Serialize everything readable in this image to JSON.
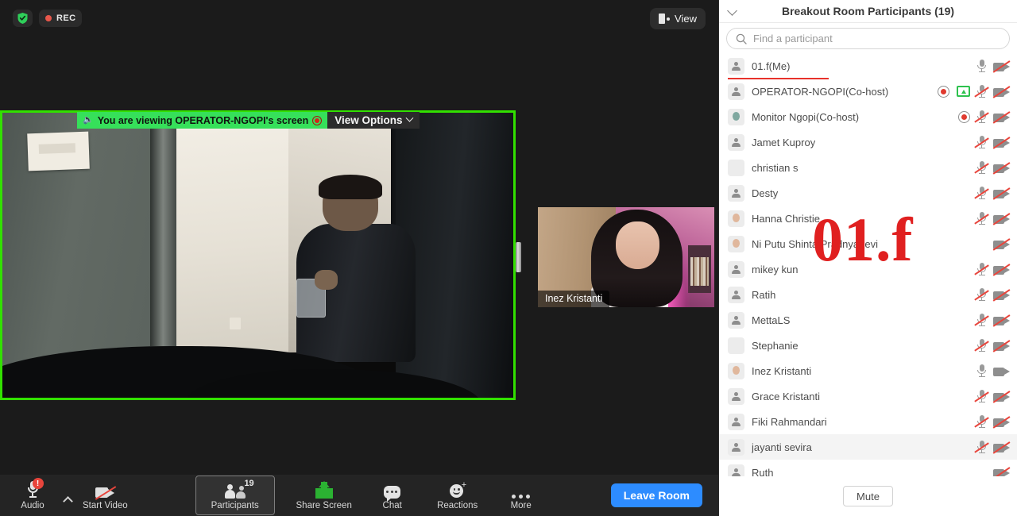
{
  "stage": {
    "security_icon": "shield-check-icon",
    "recording_label": "REC",
    "view_button_label": "View",
    "share_banner": {
      "text": "You are viewing OPERATOR-NGOPI's screen",
      "view_options_label": "View Options",
      "speaker_icon": "speaker-icon",
      "recording_icon": "recording-indicator-icon"
    },
    "thumbnail_name": "Inez Kristanti"
  },
  "toolbar": {
    "items": [
      {
        "label": "Audio",
        "icon": "microphone-icon",
        "badge": "!",
        "state": "muted-warning"
      },
      {
        "label": "Start Video",
        "icon": "video-off-icon",
        "state": "off"
      },
      {
        "label": "Participants",
        "icon": "participants-icon",
        "count": "19",
        "state": "active"
      },
      {
        "label": "Share Screen",
        "icon": "share-screen-icon"
      },
      {
        "label": "Chat",
        "icon": "chat-icon"
      },
      {
        "label": "Reactions",
        "icon": "reactions-icon"
      },
      {
        "label": "More",
        "icon": "more-icon"
      }
    ],
    "leave_label": "Leave Room",
    "leave_color": "#2d8cff"
  },
  "panel": {
    "title": "Breakout Room Participants (19)",
    "collapse_icon": "chevron-down-icon",
    "search_placeholder": "Find a participant",
    "search_value": "",
    "search_icon": "search-icon",
    "mute_label": "Mute",
    "watermark": "01.f",
    "watermark_color": "#e02020",
    "me_underline_color": "#e8322b",
    "participants": [
      {
        "name": "01.f(Me)",
        "avatar": "default",
        "mic": "on",
        "cam": "off",
        "rec": false,
        "screen": false,
        "underline": true,
        "hovered": false
      },
      {
        "name": "OPERATOR-NGOPI(Co-host)",
        "avatar": "default",
        "mic": "off",
        "cam": "off",
        "rec": true,
        "screen": true,
        "underline": false,
        "hovered": false
      },
      {
        "name": "Monitor Ngopi(Co-host)",
        "avatar": "photo-a",
        "mic": "off",
        "cam": "off",
        "rec": true,
        "screen": false,
        "underline": false,
        "hovered": false
      },
      {
        "name": "Jamet Kuproy",
        "avatar": "default",
        "mic": "off",
        "cam": "off",
        "rec": false,
        "screen": false,
        "underline": false,
        "hovered": false
      },
      {
        "name": "christian s",
        "avatar": "photo-b",
        "mic": "off",
        "cam": "off",
        "rec": false,
        "screen": false,
        "underline": false,
        "hovered": false
      },
      {
        "name": "Desty",
        "avatar": "default",
        "mic": "off",
        "cam": "off",
        "rec": false,
        "screen": false,
        "underline": false,
        "hovered": false
      },
      {
        "name": "Hanna Christie",
        "avatar": "photo-c",
        "mic": "off",
        "cam": "off",
        "rec": false,
        "screen": false,
        "underline": false,
        "hovered": false
      },
      {
        "name": "Ni Putu Shinta Pradnyadevi",
        "avatar": "photo-d",
        "mic": "none",
        "cam": "off",
        "rec": false,
        "screen": false,
        "underline": false,
        "hovered": false
      },
      {
        "name": "mikey kun",
        "avatar": "default",
        "mic": "off",
        "cam": "off",
        "rec": false,
        "screen": false,
        "underline": false,
        "hovered": false
      },
      {
        "name": "Ratih",
        "avatar": "default",
        "mic": "off",
        "cam": "off",
        "rec": false,
        "screen": false,
        "underline": false,
        "hovered": false
      },
      {
        "name": "MettaLS",
        "avatar": "default",
        "mic": "off",
        "cam": "off",
        "rec": false,
        "screen": false,
        "underline": false,
        "hovered": false
      },
      {
        "name": "Stephanie",
        "avatar": "photo-e",
        "mic": "off",
        "cam": "off",
        "rec": false,
        "screen": false,
        "underline": false,
        "hovered": false
      },
      {
        "name": "Inez Kristanti",
        "avatar": "photo-f",
        "mic": "on",
        "cam": "on",
        "rec": false,
        "screen": false,
        "underline": false,
        "hovered": false
      },
      {
        "name": "Grace Kristanti",
        "avatar": "default",
        "mic": "off",
        "cam": "off",
        "rec": false,
        "screen": false,
        "underline": false,
        "hovered": false
      },
      {
        "name": "Fiki Rahmandari",
        "avatar": "default",
        "mic": "off",
        "cam": "off",
        "rec": false,
        "screen": false,
        "underline": false,
        "hovered": false
      },
      {
        "name": "jayanti sevira",
        "avatar": "default",
        "mic": "off",
        "cam": "off",
        "rec": false,
        "screen": false,
        "underline": false,
        "hovered": true
      },
      {
        "name": "Ruth",
        "avatar": "default",
        "mic": "none",
        "cam": "off",
        "rec": false,
        "screen": false,
        "underline": false,
        "hovered": false
      }
    ]
  }
}
